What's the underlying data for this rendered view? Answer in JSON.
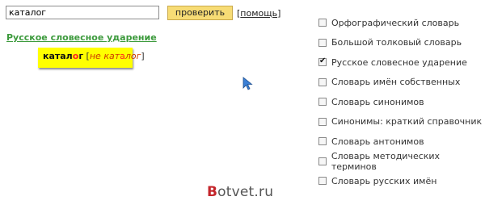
{
  "search": {
    "value": "каталог",
    "button_label": "проверить",
    "help_open": "[",
    "help_label": "помощь",
    "help_close": "]"
  },
  "result": {
    "dictionary_title": "Русское словесное ударение",
    "word_before_accent": "катал",
    "word_accent": "о",
    "word_after_accent": "г",
    "alt_open": " [",
    "alt_negation": "не",
    "alt_space": " ",
    "alt_before_accent": "кат",
    "alt_accent": "а",
    "alt_after_accent": "лог",
    "alt_close": "]"
  },
  "dictionaries": [
    {
      "label": "Орфографический словарь",
      "checked": false
    },
    {
      "label": "Большой толковый словарь",
      "checked": false
    },
    {
      "label": "Русское словесное ударение",
      "checked": true
    },
    {
      "label": "Словарь имён собственных",
      "checked": false
    },
    {
      "label": "Словарь синонимов",
      "checked": false
    },
    {
      "label": "Синонимы: краткий справочник",
      "checked": false
    },
    {
      "label": "Словарь антонимов",
      "checked": false
    },
    {
      "label": "Словарь методических терминов",
      "checked": false
    },
    {
      "label": "Словарь русских имён",
      "checked": false
    }
  ],
  "watermark": {
    "first_letter": "B",
    "rest": "otvet.ru"
  },
  "colors": {
    "button_bg": "#f7dc75",
    "highlight_bg": "#ffff00",
    "accent": "#ff2020",
    "dictionary_title": "#3c9a3c",
    "cursor": "#3a7fd5"
  },
  "icons": {
    "cursor": "mouse-pointer-icon",
    "checkbox_checked": "checkmark-icon"
  }
}
